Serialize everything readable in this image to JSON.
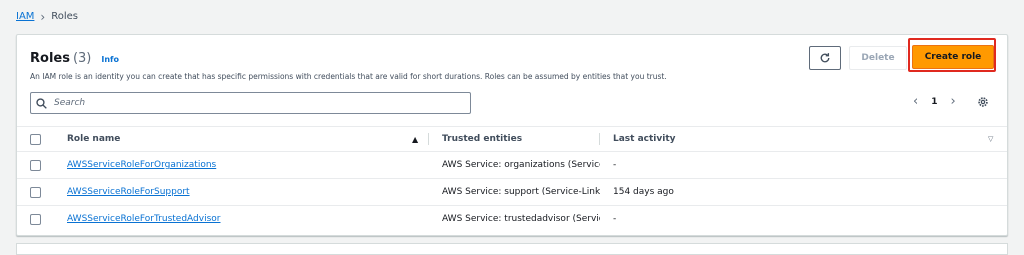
{
  "breadcrumb": {
    "root": "IAM",
    "current": "Roles"
  },
  "header": {
    "title": "Roles",
    "count": "(3)",
    "info": "Info",
    "description": "An IAM role is an identity you can create that has specific permissions with credentials that are valid for short durations. Roles can be assumed by entities that you trust."
  },
  "actions": {
    "delete": "Delete",
    "create": "Create role"
  },
  "search": {
    "placeholder": "Search",
    "value": ""
  },
  "pagination": {
    "current_page": "1",
    "prev": "‹",
    "next": "›"
  },
  "table": {
    "columns": [
      "Role name",
      "Trusted entities",
      "Last activity"
    ],
    "rows": [
      {
        "name": "AWSServiceRoleForOrganizations",
        "trusted": "AWS Service: organizations (Service-",
        "activity": "-"
      },
      {
        "name": "AWSServiceRoleForSupport",
        "trusted": "AWS Service: support (Service-Linked",
        "activity": "154 days ago"
      },
      {
        "name": "AWSServiceRoleForTrustedAdvisor",
        "trusted": "AWS Service: trustedadvisor (Service",
        "activity": "-"
      }
    ]
  },
  "colors": {
    "link": "#0972d3",
    "primary": "#ff9900",
    "highlight": "#e0291f"
  },
  "icons": {
    "refresh": "refresh-icon",
    "search": "search-icon",
    "settings": "gear-icon",
    "sort": "sort-ascending-icon",
    "filter": "caret-down-icon"
  }
}
